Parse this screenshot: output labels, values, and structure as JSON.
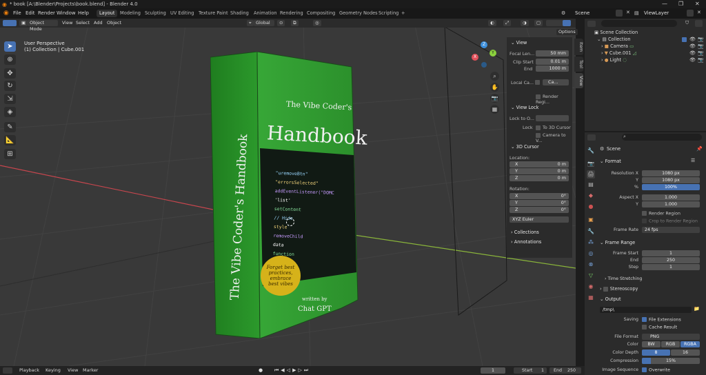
{
  "window": {
    "title": "* book [A:\\Blender\\Projects\\book.blend] - Blender 4.0"
  },
  "menu": {
    "items": [
      "File",
      "Edit",
      "Render",
      "Window",
      "Help"
    ]
  },
  "workspaces": [
    "Layout",
    "Modeling",
    "Sculpting",
    "UV Editing",
    "Texture Paint",
    "Shading",
    "Animation",
    "Rendering",
    "Compositing",
    "Geometry Nodes",
    "Scripting"
  ],
  "workspace_add": "+",
  "topright": {
    "scene": "Scene",
    "view_layer": "ViewLayer"
  },
  "viewport_header": {
    "mode": "Object Mode",
    "menus": [
      "View",
      "Select",
      "Add",
      "Object"
    ],
    "orientation": "Global",
    "options": "Options"
  },
  "overlay_text": {
    "view_name": "User Perspective",
    "selection": "(1) Collection | Cube.001"
  },
  "gizmo": {
    "x": "X",
    "y": "Y",
    "z": "Z"
  },
  "book": {
    "title_small": "The Vibe Coder's",
    "title_large": "Handbook",
    "spine": "The Vibe Coder's Handbook",
    "badge": "Forget best practices, embrace best vibes",
    "author_prefix": "written by",
    "author": "Chat GPT",
    "code_lines": [
      "\"uremoveBtn\"",
      "\"errorsSelected\"",
      "addEventListener(\"DOMC",
      "'list'",
      "setContent",
      "// Hide",
      "style",
      "removeChild",
      "data",
      "function"
    ]
  },
  "npanel": {
    "tabs": [
      "Item",
      "Tool",
      "View"
    ],
    "view_header": "View",
    "focal_label": "Focal Len...",
    "focal_value": "50 mm",
    "clip_start_label": "Clip Start",
    "clip_start_value": "0.01 m",
    "clip_end_label": "End",
    "clip_end_value": "1000 m",
    "local_camera_label": "Local Ca...",
    "local_camera_value": "Ca...",
    "render_region": "Render Regi...",
    "viewlock_header": "View Lock",
    "lock_object_label": "Lock to O...",
    "lock_label": "Lock",
    "lock_3d_cursor": "To 3D Cursor",
    "camera_to_view": "Camera to V...",
    "cursor_header": "3D Cursor",
    "location_label": "Location:",
    "loc_x_label": "X",
    "loc_x": "0 m",
    "loc_y_label": "Y",
    "loc_y": "0 m",
    "loc_z_label": "Z",
    "loc_z": "0 m",
    "rotation_label": "Rotation:",
    "rot_x_label": "X",
    "rot_x": "0°",
    "rot_y_label": "Y",
    "rot_y": "0°",
    "rot_z_label": "Z",
    "rot_z": "0°",
    "rotation_mode": "XYZ Euler",
    "collections_header": "Collections",
    "annotations_header": "Annotations"
  },
  "outliner": {
    "scene_collection": "Scene Collection",
    "collection": "Collection",
    "items": [
      {
        "name": "Camera",
        "color": "#d89a55"
      },
      {
        "name": "Cube.001",
        "color": "#d89a55"
      },
      {
        "name": "Light",
        "color": "#d89a55"
      }
    ]
  },
  "properties": {
    "scene": "Scene",
    "format_header": "Format",
    "res_x_label": "Resolution X",
    "res_x": "1080 px",
    "res_y_label": "Y",
    "res_y": "1080 px",
    "res_pct_label": "%",
    "res_pct": "100%",
    "aspect_x_label": "Aspect X",
    "aspect_x": "1.000",
    "aspect_y_label": "Y",
    "aspect_y": "1.000",
    "render_region": "Render Region",
    "crop": "Crop to Render Region",
    "frame_rate_label": "Frame Rate",
    "frame_rate": "24 fps",
    "frame_range_header": "Frame Range",
    "frame_start_label": "Frame Start",
    "frame_start": "1",
    "frame_end_label": "End",
    "frame_end": "250",
    "step_label": "Step",
    "step": "1",
    "time_stretching": "Time Stretching",
    "stereoscopy": "Stereoscopy",
    "output_header": "Output",
    "output_path": "/tmp\\",
    "saving_label": "Saving",
    "file_extensions": "File Extensions",
    "cache_result": "Cache Result",
    "file_format_label": "File Format",
    "file_format": "PNG",
    "color_label": "Color",
    "color_options": [
      "BW",
      "RGB",
      "RGBA"
    ],
    "color_depth_label": "Color Depth",
    "color_depth_options": [
      "8",
      "16"
    ],
    "compression_label": "Compression",
    "compression": "15%",
    "compression_level": 0.15,
    "image_sequence_label": "Image Sequence",
    "overwrite": "Overwrite"
  },
  "timeline": {
    "menus": [
      "Playback",
      "Keying",
      "View",
      "Marker"
    ],
    "current_frame": "1",
    "start_label": "Start",
    "start": "1",
    "end_label": "End",
    "end": "250"
  },
  "colors": {
    "accent": "#4772b3",
    "book_green": "#2f9a2f",
    "badge_yellow": "#d6b21a",
    "x_axis": "#e2515b",
    "y_axis": "#8bd13e",
    "z_axis": "#3d8fdb"
  }
}
